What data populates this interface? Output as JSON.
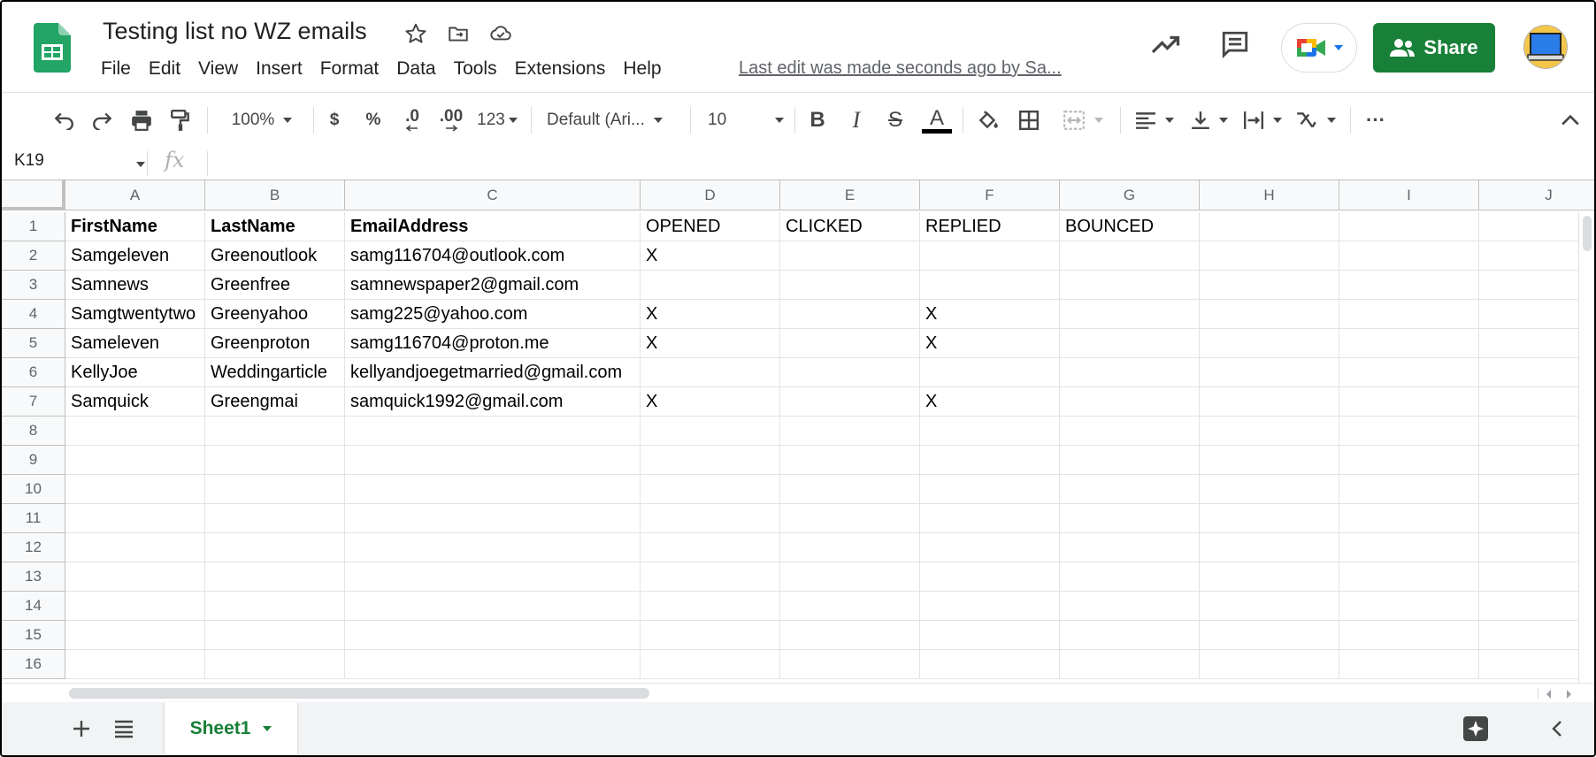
{
  "doc": {
    "title": "Testing list no WZ emails",
    "last_edit": "Last edit was made seconds ago by Sa..."
  },
  "menu": [
    "File",
    "Edit",
    "View",
    "Insert",
    "Format",
    "Data",
    "Tools",
    "Extensions",
    "Help"
  ],
  "share_label": "Share",
  "toolbar": {
    "zoom": "100%",
    "currency": "$",
    "percent": "%",
    "decrease_decimal": ".0",
    "increase_decimal": ".00",
    "more_formats": "123",
    "font": "Default (Ari...",
    "font_size": "10",
    "bold": "B",
    "italic": "I",
    "strike": "S",
    "text_color": "A",
    "more": "···"
  },
  "formula_bar": {
    "cell_ref": "K19",
    "fx": "fx"
  },
  "columns": [
    "A",
    "B",
    "C",
    "D",
    "E",
    "F",
    "G",
    "H",
    "I",
    "J"
  ],
  "row_numbers": [
    "1",
    "2",
    "3",
    "4",
    "5",
    "6",
    "7",
    "8",
    "9",
    "10",
    "11",
    "12",
    "13",
    "14",
    "15",
    "16"
  ],
  "rows": [
    [
      "FirstName",
      "LastName",
      "EmailAddress",
      "OPENED",
      "CLICKED",
      "REPLIED",
      "BOUNCED",
      "",
      "",
      ""
    ],
    [
      "Samgeleven",
      "Greenoutlook",
      "samg116704@outlook.com",
      "X",
      "",
      "",
      "",
      "",
      "",
      ""
    ],
    [
      "Samnews",
      "Greenfree",
      "samnewspaper2@gmail.com",
      "",
      "",
      "",
      "",
      "",
      "",
      ""
    ],
    [
      "Samgtwentytwo",
      "Greenyahoo",
      "samg225@yahoo.com",
      "X",
      "",
      "X",
      "",
      "",
      "",
      ""
    ],
    [
      "Sameleven",
      "Greenproton",
      "samg116704@proton.me",
      "X",
      "",
      "X",
      "",
      "",
      "",
      ""
    ],
    [
      "KellyJoe",
      "Weddingarticle",
      "kellyandjoegetmarried@gmail.com",
      "",
      "",
      "",
      "",
      "",
      "",
      ""
    ],
    [
      "Samquick",
      "Greengmai",
      "samquick1992@gmail.com",
      "X",
      "",
      "X",
      "",
      "",
      "",
      ""
    ]
  ],
  "sheet_tab": "Sheet1",
  "colors": {
    "brand_green": "#188038",
    "header_bg": "#f8f9fa",
    "grid_line": "#e2e3e3"
  }
}
